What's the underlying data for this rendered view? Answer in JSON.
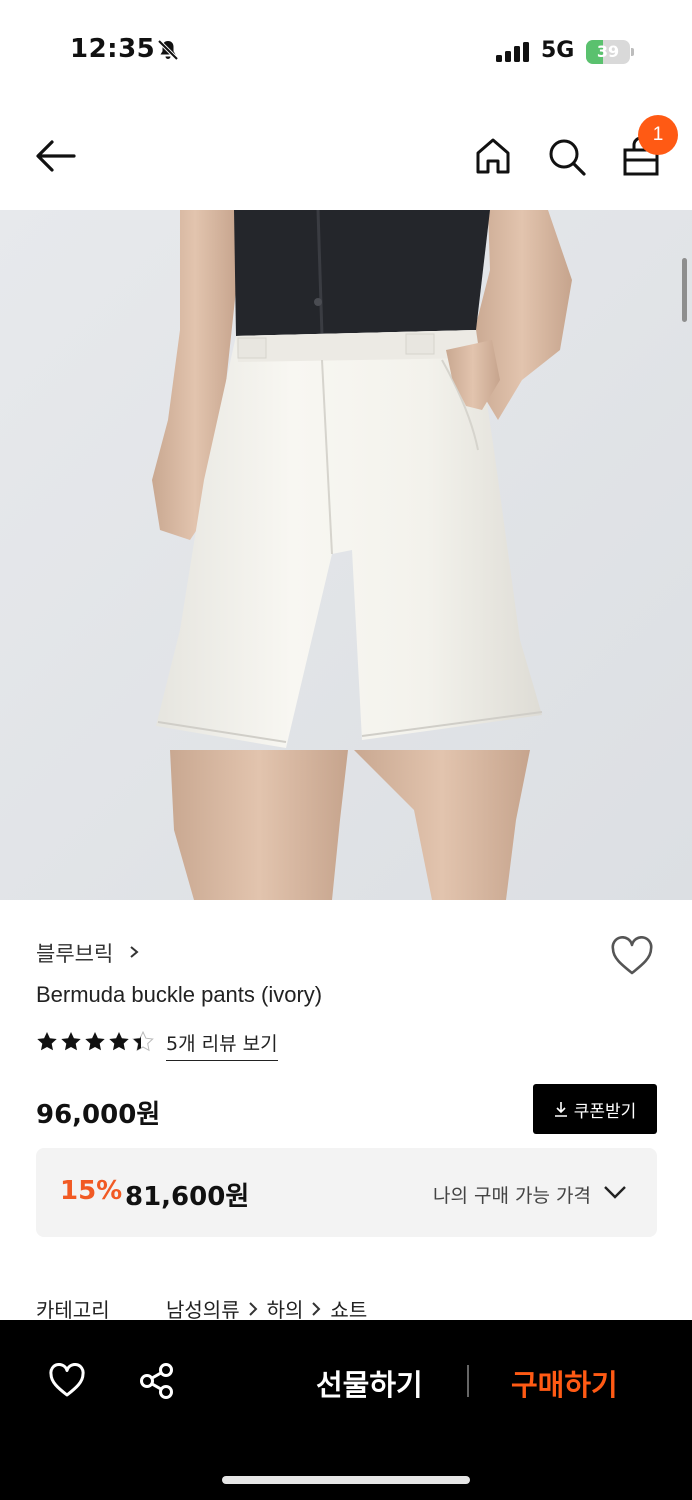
{
  "status_bar": {
    "time": "12:35",
    "network": "5G",
    "battery": "39",
    "battery_level": 0.39
  },
  "nav": {
    "cart_count": "1"
  },
  "product": {
    "brand": "블루브릭",
    "title": "Bermuda buckle pants (ivory)",
    "rating": 4.5,
    "review_link": "5개 리뷰 보기",
    "price": "96,000원",
    "coupon_label": "쿠폰받기",
    "discount": "15%",
    "sale_price": "81,600원",
    "my_price_label": "나의 구매 가능 가격",
    "category_label": "카테고리",
    "category_path": [
      "남성의류",
      "하의",
      "쇼트"
    ]
  },
  "bottom_bar": {
    "gift_label": "선물하기",
    "buy_label": "구매하기"
  },
  "colors": {
    "accent": "#ff5a14",
    "discount": "#f15a24",
    "battery": "#5ac16e"
  }
}
